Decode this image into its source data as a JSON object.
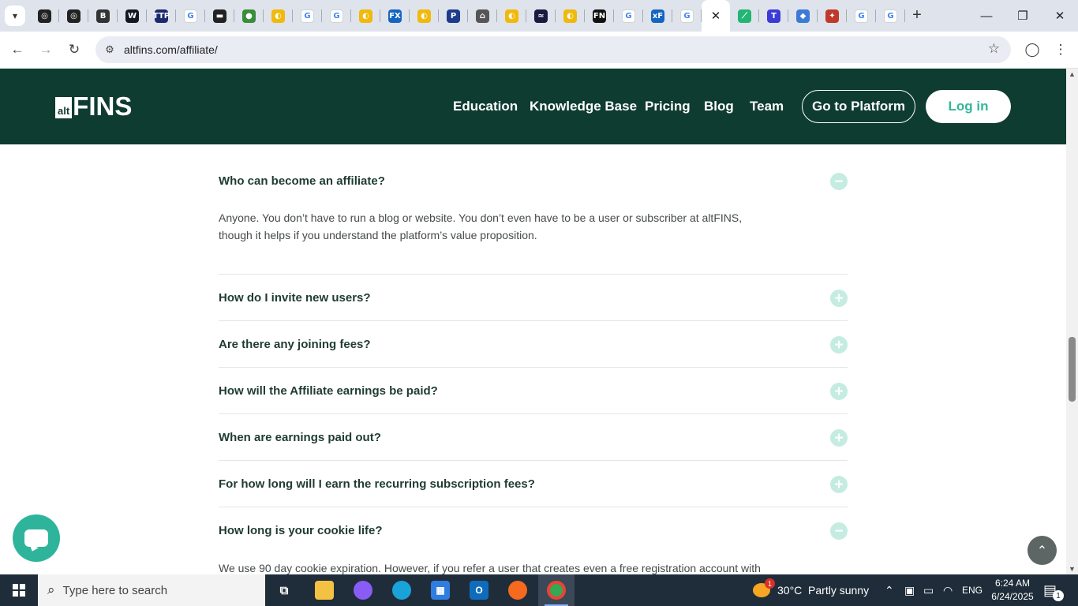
{
  "browser": {
    "tabs": [
      {
        "icon": "openai-icon",
        "color": "#222222",
        "glyph": "◎"
      },
      {
        "icon": "openai-icon",
        "color": "#222222",
        "glyph": "◎"
      },
      {
        "icon": "b-icon",
        "color": "#333333",
        "glyph": "B"
      },
      {
        "icon": "tradingview-icon",
        "color": "#131722",
        "glyph": "W"
      },
      {
        "icon": "ttp-icon",
        "color": "#1a2a6c",
        "glyph": "TTP"
      },
      {
        "icon": "google-icon",
        "color": "#4285f4",
        "glyph": "G"
      },
      {
        "icon": "dark-app-icon",
        "color": "#222222",
        "glyph": "▬"
      },
      {
        "icon": "green-globe-icon",
        "color": "#3a8d3a",
        "glyph": "●"
      },
      {
        "icon": "yellow-coin-icon",
        "color": "#f0b90b",
        "glyph": "◐"
      },
      {
        "icon": "google-icon",
        "color": "#4285f4",
        "glyph": "G"
      },
      {
        "icon": "google-icon",
        "color": "#4285f4",
        "glyph": "G"
      },
      {
        "icon": "yellow-coin-icon",
        "color": "#f0b90b",
        "glyph": "◐"
      },
      {
        "icon": "fx-icon",
        "color": "#1565c0",
        "glyph": "FX"
      },
      {
        "icon": "yellow-coin-icon",
        "color": "#f0b90b",
        "glyph": "◐"
      },
      {
        "icon": "paypal-icon",
        "color": "#1e3a8a",
        "glyph": "P"
      },
      {
        "icon": "chart-house-icon",
        "color": "#555555",
        "glyph": "⌂"
      },
      {
        "icon": "yellow-coin-icon",
        "color": "#f0b90b",
        "glyph": "◐"
      },
      {
        "icon": "dark-blue-app-icon",
        "color": "#1a1a40",
        "glyph": "≈"
      },
      {
        "icon": "yellow-coin-icon",
        "color": "#f0b90b",
        "glyph": "◐"
      },
      {
        "icon": "fn-icon",
        "color": "#111111",
        "glyph": "FN"
      },
      {
        "icon": "google-icon",
        "color": "#4285f4",
        "glyph": "G"
      },
      {
        "icon": "excel-fx-icon",
        "color": "#1565c0",
        "glyph": "xF"
      },
      {
        "icon": "google-icon",
        "color": "#4285f4",
        "glyph": "G"
      },
      {
        "icon": "close-icon",
        "color": "#ffffff",
        "glyph": "✕",
        "active": true
      },
      {
        "icon": "leaf-icon",
        "color": "#22b573",
        "glyph": "⟋"
      },
      {
        "icon": "t-icon",
        "color": "#3b3bd6",
        "glyph": "T"
      },
      {
        "icon": "blue-diamond-icon",
        "color": "#3d7ad6",
        "glyph": "◆"
      },
      {
        "icon": "puzzle-icon",
        "color": "#c0392b",
        "glyph": "✦"
      },
      {
        "icon": "google-icon",
        "color": "#4285f4",
        "glyph": "G"
      },
      {
        "icon": "google-icon",
        "color": "#4285f4",
        "glyph": "G"
      }
    ],
    "url": "altfins.com/affiliate/"
  },
  "site": {
    "logo_alt": "alt",
    "logo_fins": "FINS",
    "nav": [
      "Education",
      "Knowledge Base",
      "Pricing",
      "Blog",
      "Team"
    ],
    "platform_button": "Go to Platform",
    "login_button": "Log in",
    "colors": {
      "header_bg": "#0f3c30",
      "accent": "#34b79a"
    }
  },
  "faq": {
    "items": [
      {
        "question": "Who can become an affiliate?",
        "expanded": true,
        "answer_lines": [
          "Anyone. You don’t have to run a blog or website. You don’t even have to be a user or subscriber at altFINS,",
          "though it helps if you understand the platform’s value proposition."
        ]
      },
      {
        "question": "How do I invite new users?",
        "expanded": false
      },
      {
        "question": "Are there any joining fees?",
        "expanded": false
      },
      {
        "question": "How will the Affiliate earnings be paid?",
        "expanded": false
      },
      {
        "question": "When are earnings paid out?",
        "expanded": false
      },
      {
        "question": "For how long will I earn the recurring subscription fees?",
        "expanded": false
      },
      {
        "question": "How long is your cookie life?",
        "expanded": true,
        "answer_lines": [
          "We use 90 day cookie expiration. However, if you refer a user that creates even a free registration account with"
        ]
      }
    ],
    "expanded_symbol": "−",
    "collapsed_symbol": "+"
  },
  "taskbar": {
    "search_placeholder": "Type here to search",
    "weather": "30°C  Partly sunny",
    "weather_badge": "1",
    "language": "ENG",
    "time": "6:24 AM",
    "date": "6/24/2025",
    "notification_count": "1"
  }
}
